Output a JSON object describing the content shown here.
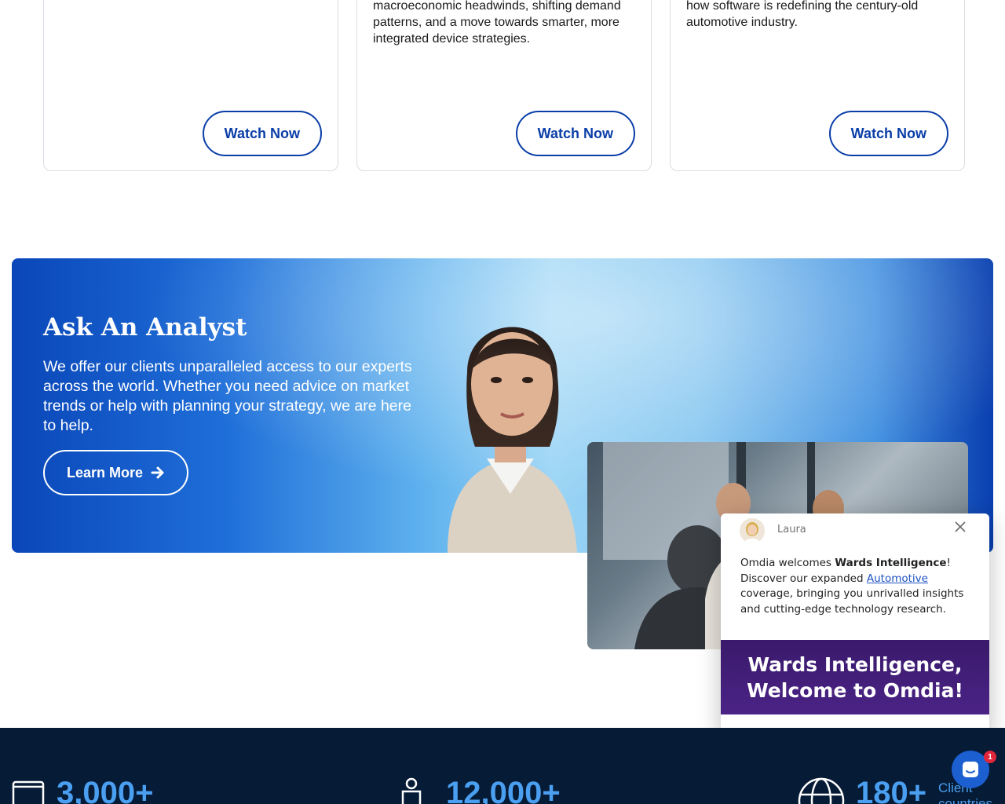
{
  "cards": [
    {
      "text": "",
      "button": "Watch Now"
    },
    {
      "text": "macroeconomic headwinds, shifting demand patterns, and a move towards smarter, more integrated device strategies.",
      "button": "Watch Now"
    },
    {
      "text": "how software is redefining the century-old automotive industry.",
      "button": "Watch Now"
    }
  ],
  "banner": {
    "title": "Ask An Analyst",
    "description": "We offer our clients unparalleled access to our experts across the world. Whether you need advice on market trends or help with planning your strategy, we are here to help.",
    "button": "Learn More"
  },
  "chat": {
    "agent_name": "Laura",
    "msg_prefix": "Omdia welcomes ",
    "msg_bold": "Wards Intelligence",
    "msg_after_bold": "! Discover our expanded ",
    "msg_link": "Automotive",
    "msg_suffix": " coverage, bringing you unrivalled insights and cutting-edge technology research.",
    "promo_line1": "Wards Intelligence,",
    "promo_line2": "Welcome to Omdia!"
  },
  "launcher": {
    "badge": "1"
  },
  "stats": [
    {
      "value": "3,000+",
      "label": ""
    },
    {
      "value": "12,000+",
      "label": ""
    },
    {
      "value": "180+",
      "label": "Client countries"
    }
  ],
  "colors": {
    "brand_blue": "#0a3ea8",
    "stat_blue": "#4a9ff0",
    "footer_bg": "#051b36",
    "promo_purple": "#4b2386"
  }
}
